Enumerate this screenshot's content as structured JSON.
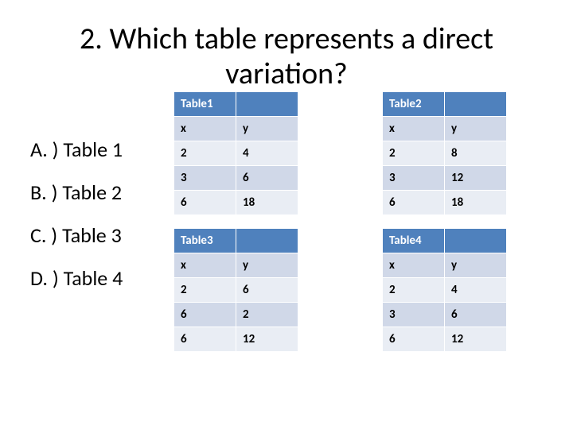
{
  "title_line1": "2. Which table represents a direct",
  "title_line2": "variation?",
  "answers": {
    "a": "A. ) Table 1",
    "b": "B. ) Table 2",
    "c": "C. ) Table 3",
    "d": "D. ) Table 4"
  },
  "tables": {
    "t1": {
      "label": "Table1",
      "hx": "x",
      "hy": "y",
      "rows": [
        {
          "x": "2",
          "y": "4"
        },
        {
          "x": "3",
          "y": "6"
        },
        {
          "x": "6",
          "y": "18"
        }
      ]
    },
    "t2": {
      "label": "Table2",
      "hx": "x",
      "hy": "y",
      "rows": [
        {
          "x": "2",
          "y": "8"
        },
        {
          "x": "3",
          "y": "12"
        },
        {
          "x": "6",
          "y": "18"
        }
      ]
    },
    "t3": {
      "label": "Table3",
      "hx": "x",
      "hy": "y",
      "rows": [
        {
          "x": "2",
          "y": "6"
        },
        {
          "x": "6",
          "y": "2"
        },
        {
          "x": "6",
          "y": "12"
        }
      ]
    },
    "t4": {
      "label": "Table4",
      "hx": "x",
      "hy": "y",
      "rows": [
        {
          "x": "2",
          "y": "4"
        },
        {
          "x": "3",
          "y": "6"
        },
        {
          "x": "6",
          "y": "12"
        }
      ]
    }
  },
  "chart_data": [
    {
      "type": "table",
      "title": "Table1",
      "columns": [
        "x",
        "y"
      ],
      "rows": [
        [
          2,
          4
        ],
        [
          3,
          6
        ],
        [
          6,
          18
        ]
      ]
    },
    {
      "type": "table",
      "title": "Table2",
      "columns": [
        "x",
        "y"
      ],
      "rows": [
        [
          2,
          8
        ],
        [
          3,
          12
        ],
        [
          6,
          18
        ]
      ]
    },
    {
      "type": "table",
      "title": "Table3",
      "columns": [
        "x",
        "y"
      ],
      "rows": [
        [
          2,
          6
        ],
        [
          6,
          2
        ],
        [
          6,
          12
        ]
      ]
    },
    {
      "type": "table",
      "title": "Table4",
      "columns": [
        "x",
        "y"
      ],
      "rows": [
        [
          2,
          4
        ],
        [
          3,
          6
        ],
        [
          6,
          12
        ]
      ]
    }
  ]
}
